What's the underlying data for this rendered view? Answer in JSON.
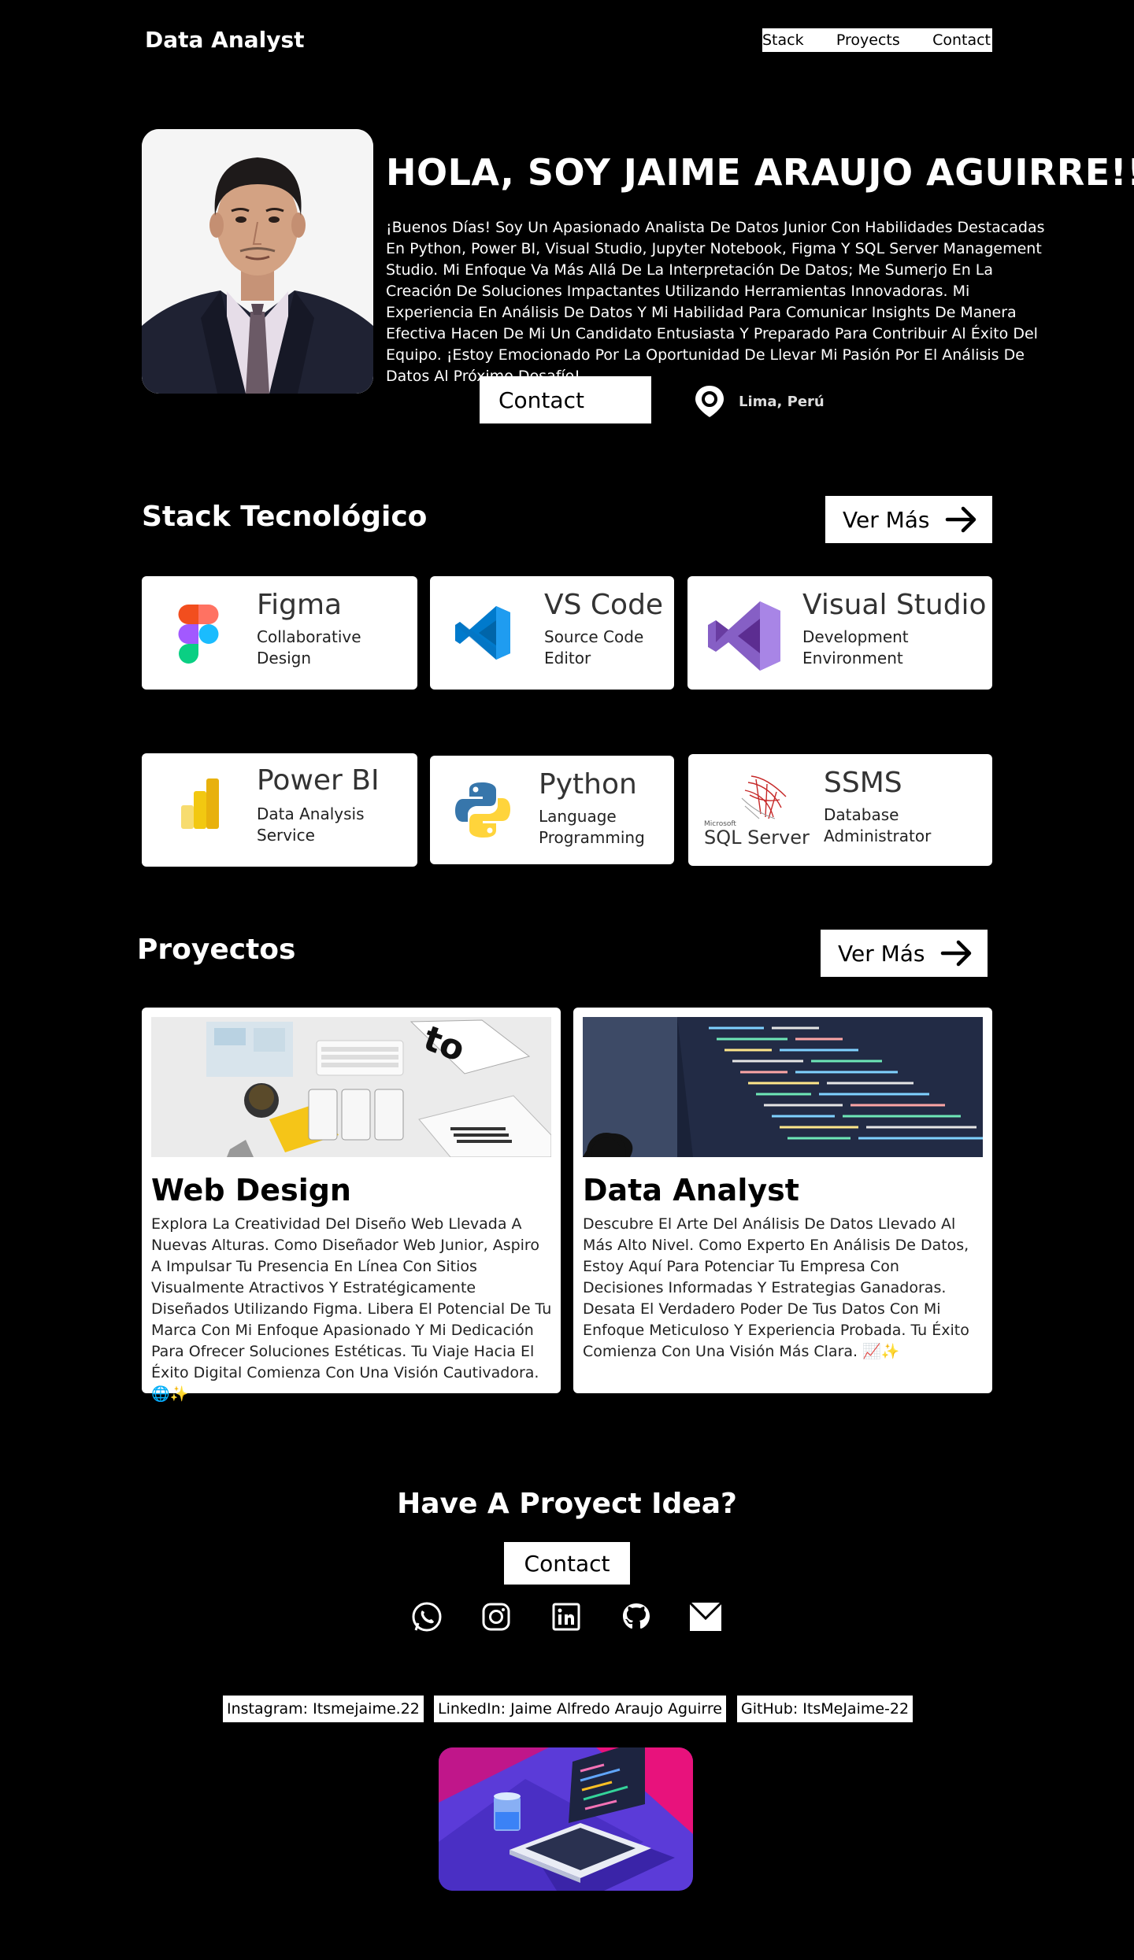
{
  "header": {
    "brand": "Data Analyst",
    "nav": [
      "Stack",
      "Proyects",
      "Contact"
    ]
  },
  "hero": {
    "title": "HOLA, SOY JAIME ARAUJO AGUIRRE!!",
    "text": "¡Buenos Días! Soy Un Apasionado Analista De Datos Junior Con Habilidades Destacadas En Python, Power BI, Visual Studio, Jupyter Notebook, Figma Y SQL Server Management Studio. Mi Enfoque Va Más Allá De La Interpretación De Datos; Me Sumerjo En La Creación De Soluciones Impactantes Utilizando Herramientas Innovadoras. Mi Experiencia En Análisis De Datos Y Mi Habilidad Para Comunicar Insights De Manera Efectiva Hacen De Mi Un Candidato Entusiasta Y Preparado Para Contribuir Al Éxito Del Equipo. ¡Estoy Emocionado Por La Oportunidad De Llevar Mi Pasión Por El Análisis De Datos Al Próximo Desafío!",
    "contact_label": "Contact",
    "location": "Lima, Perú"
  },
  "stack": {
    "title": "Stack Tecnológico",
    "ver_mas": "Ver Más",
    "cards": [
      {
        "name": "Figma",
        "desc": "Collaborative Design",
        "icon": "figma-icon"
      },
      {
        "name": "VS Code",
        "desc": "Source Code Editor",
        "icon": "vscode-icon"
      },
      {
        "name": "Visual Studio",
        "desc": "Development Environment",
        "icon": "visual-studio-icon"
      },
      {
        "name": "Power BI",
        "desc": "Data Analysis Service",
        "icon": "power-bi-icon"
      },
      {
        "name": "Python",
        "desc": "Language Programming",
        "icon": "python-icon"
      },
      {
        "name": "SSMS",
        "desc": "Database Administrator",
        "icon": "sql-server-icon",
        "logo_small": "Microsoft",
        "logo_text": "SQL Server"
      }
    ]
  },
  "projects": {
    "title": "Proyectos",
    "ver_mas": "Ver Más",
    "items": [
      {
        "title": "Web Design",
        "text": "Explora La Creatividad Del Diseño Web Llevada A Nuevas Alturas. Como Diseñador Web Junior, Aspiro A Impulsar Tu Presencia En Línea Con Sitios Visualmente Atractivos Y Estratégicamente Diseñados Utilizando Figma. Libera El Potencial De Tu Marca Con Mi Enfoque Apasionado Y Mi Dedicación Para Ofrecer Soluciones Estéticas. Tu Viaje Hacia El Éxito Digital Comienza Con Una Visión Cautivadora. 🌐✨"
      },
      {
        "title": "Data Analyst",
        "text": "Descubre El Arte Del Análisis De Datos Llevado Al Más Alto Nivel. Como Experto En Análisis De Datos, Estoy Aquí Para Potenciar Tu Empresa Con Decisiones Informadas Y Estrategias Ganadoras. Desata El Verdadero Poder De Tus Datos Con Mi Enfoque Meticuloso Y Experiencia Probada. Tu Éxito Comienza Con Una Visión Más Clara. 📈✨"
      }
    ]
  },
  "footer": {
    "cta": "Have A Proyect Idea?",
    "contact_label": "Contact",
    "social_icons": [
      "whatsapp-icon",
      "instagram-icon",
      "linkedin-icon",
      "github-icon",
      "mail-icon"
    ],
    "tags": [
      "Instagram: Itsmejaime.22",
      "LinkedIn: Jaime Alfredo Araujo Aguirre",
      "GitHub: ItsMeJaime-22"
    ]
  },
  "colors": {
    "background": "#000000",
    "surface": "#ffffff",
    "text_dark": "#222222"
  }
}
